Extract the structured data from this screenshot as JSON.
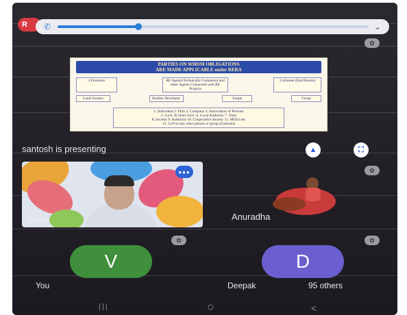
{
  "top_bar": {
    "badge": "R",
    "phone_icon": "phone-icon",
    "expand_icon": "chevron-down-icon",
    "progress": 0.26
  },
  "slide": {
    "heading_line1": "PARTIES ON WHOM OBLIGATIONS",
    "heading_line2": "ARE MADE APPLICABLE under RERA",
    "box_promoter": "1.Promoter",
    "box_real_estate_agent": "RE Agents/Technically Competent and other Agents Connected with RE Projects",
    "box_allottee": "3.Allottee (End Buyers)",
    "box_land_owners": "Land Owners",
    "box_builder": "Builder Developer",
    "box_single": "Single",
    "box_group": "Group",
    "footer_line1": "1. Individual 2. Firm 3. Company 4. Association of Persons",
    "footer_line2": "5. Govt. & Semi Govt. 6. Local Authority 7. Trust",
    "footer_line3": "8. Society 9. Authority 10. Cooperative Society 11. MOUs etc",
    "footer_line4": "12. LLP or any other person or group of persons"
  },
  "presenting_text": "santosh is presenting",
  "participants": {
    "presenter_tile_name": "santosh",
    "anuradha": "Anuradha",
    "you_initial": "V",
    "you_label": "You",
    "deepak_initial": "D",
    "deepak_label": "Deepak",
    "others_label": "95 others"
  },
  "colors": {
    "you_avatar": "#3f8f3c",
    "deepak_avatar": "#6b5fd0",
    "accent": "#2a7ed8"
  },
  "nav": {
    "recents": "|||",
    "home": "○",
    "back": "<"
  }
}
